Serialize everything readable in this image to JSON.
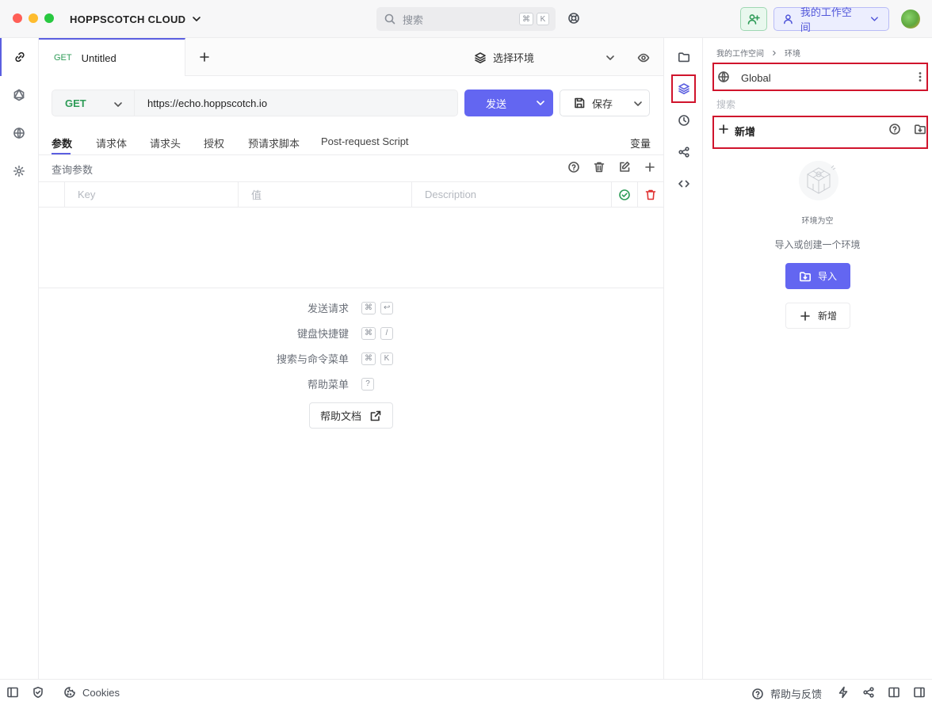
{
  "window": {
    "app_title": "HOPPSCOTCH CLOUD",
    "traffic_colors": [
      "#ff5f57",
      "#febc2e",
      "#28c840"
    ]
  },
  "header": {
    "search_placeholder": "搜索",
    "search_kbd": [
      "⌘",
      "K"
    ],
    "workspace_label": "我的工作空间"
  },
  "left_rail": {
    "items": [
      {
        "icon": "link-icon",
        "active": true
      },
      {
        "icon": "graphql-icon",
        "active": false
      },
      {
        "icon": "globe-icon",
        "active": false
      },
      {
        "icon": "gear-icon",
        "active": false
      }
    ]
  },
  "tab": {
    "method": "GET",
    "title": "Untitled"
  },
  "environment": {
    "select_label": "选择环境"
  },
  "request": {
    "method": "GET",
    "url": "https://echo.hoppscotch.io",
    "send_label": "发送",
    "save_label": "保存"
  },
  "subtabs": {
    "items": [
      "参数",
      "请求体",
      "请求头",
      "授权",
      "预请求脚本",
      "Post-request Script"
    ],
    "active": "参数",
    "variables_label": "变量"
  },
  "params": {
    "section_label": "查询参数",
    "key_placeholder": "Key",
    "value_placeholder": "值",
    "description_placeholder": "Description"
  },
  "shortcuts": [
    {
      "label": "发送请求",
      "keys": [
        "⌘",
        "↩"
      ]
    },
    {
      "label": "键盘快捷键",
      "keys": [
        "⌘",
        "/"
      ]
    },
    {
      "label": "搜索与命令菜单",
      "keys": [
        "⌘",
        "K"
      ]
    },
    {
      "label": "帮助菜单",
      "keys": [
        "?"
      ]
    }
  ],
  "docs_button_label": "帮助文档",
  "env_panel": {
    "breadcrumb": [
      "我的工作空间",
      "环境"
    ],
    "global_label": "Global",
    "search_placeholder": "搜索",
    "new_label": "新增",
    "empty_title": "环境为空",
    "empty_desc": "导入或创建一个环境",
    "import_label": "导入",
    "add_label": "新增"
  },
  "statusbar": {
    "cookies_label": "Cookies",
    "help_label": "帮助与反馈"
  },
  "colors": {
    "accent": "#6366f1",
    "get_method": "#2f9c58",
    "highlight_box": "#d0142c",
    "delete": "#e03131"
  }
}
